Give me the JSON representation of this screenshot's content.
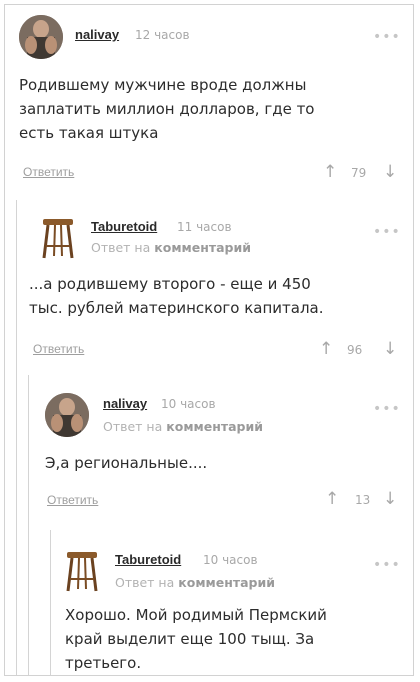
{
  "comments": [
    {
      "user": "nalivay",
      "time": "12 часов",
      "reply_to": null,
      "text_lines": [
        "Родившему мужчине вроде должны",
        "заплатить миллион долларов, где то",
        "есть такая штука"
      ],
      "answer": "Ответить",
      "votes": "79",
      "avatar": "avatar-photo"
    },
    {
      "user": "Taburetoid",
      "time": "11 часов",
      "reply_prefix": "Ответ на",
      "reply_link": "комментарий",
      "text_lines": [
        "...а родившему второго - еще и 450",
        "тыс. рублей материнского капитала."
      ],
      "answer": "Ответить",
      "votes": "96",
      "avatar": "stool-icon"
    },
    {
      "user": "nalivay",
      "time": "10 часов",
      "reply_prefix": "Ответ на",
      "reply_link": "комментарий",
      "text_lines": [
        "Э,а региональные...."
      ],
      "answer": "Ответить",
      "votes": "13",
      "avatar": "avatar-photo"
    },
    {
      "user": "Taburetoid",
      "time": "10 часов",
      "reply_prefix": "Ответ на",
      "reply_link": "комментарий",
      "text_lines": [
        "Хорошо. Мой родимый Пермский",
        "край выделит еще 100 тыщ. За",
        "третьего."
      ],
      "avatar": "stool-icon"
    }
  ],
  "menu_glyph": "•••",
  "up_glyph": "↑",
  "down_glyph": "↓",
  "colors": {
    "text": "#2c2c2c",
    "muted": "#a8a8a8",
    "thread_line": "#d4d4d4"
  }
}
